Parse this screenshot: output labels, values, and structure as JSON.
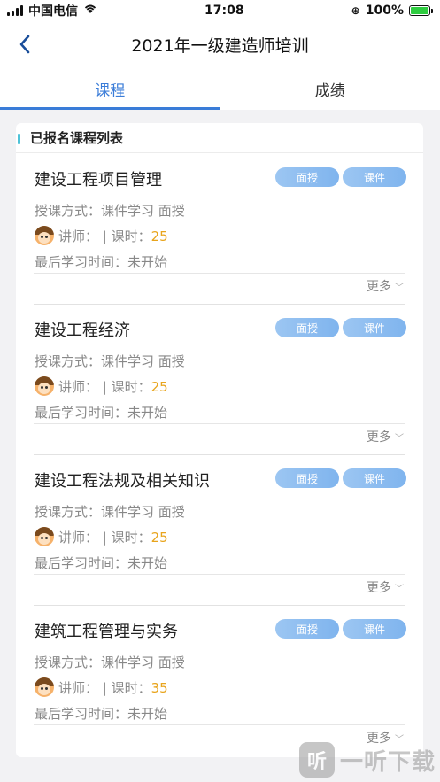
{
  "status_bar": {
    "carrier": "中国电信",
    "time": "17:08",
    "battery": "100%",
    "icons": [
      "signal-icon",
      "wifi-icon",
      "orientation-lock-icon",
      "battery-charging-icon"
    ]
  },
  "header": {
    "back_icon": "chevron-left-icon",
    "title": "2021年一级建造师培训"
  },
  "tabs": [
    {
      "label": "课程",
      "active": true
    },
    {
      "label": "成绩",
      "active": false
    }
  ],
  "section": {
    "title": "已报名课程列表"
  },
  "course_labels": {
    "method_label": "授课方式：",
    "teacher_label": "讲师：",
    "hours_label": "| 课时：",
    "last_study_label": "最后学习时间：",
    "more": "更多",
    "tag_face": "面授",
    "tag_courseware": "课件"
  },
  "courses": [
    {
      "name": "建设工程项目管理",
      "method": "课件学习 面授",
      "teacher": "",
      "hours": "25",
      "last_study": "未开始"
    },
    {
      "name": "建设工程经济",
      "method": "课件学习 面授",
      "teacher": "",
      "hours": "25",
      "last_study": "未开始"
    },
    {
      "name": "建设工程法规及相关知识",
      "method": "课件学习 面授",
      "teacher": "",
      "hours": "25",
      "last_study": "未开始"
    },
    {
      "name": "建筑工程管理与实务",
      "method": "课件学习 面授",
      "teacher": "",
      "hours": "35",
      "last_study": "未开始"
    }
  ],
  "watermark": {
    "logo_char": "听",
    "text": "一听下载"
  },
  "colors": {
    "accent": "#3a7cd8",
    "hours_value": "#e8a41c",
    "tag_gradient": "#8fbdf0",
    "section_marker": "#4ec3d8"
  }
}
